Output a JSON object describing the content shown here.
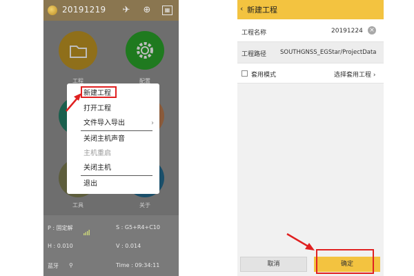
{
  "left_app": {
    "header_title": "20191219",
    "header_icons": [
      "satellite-icon",
      "rover-icon",
      "settings-panel-icon"
    ],
    "tiles": [
      {
        "name": "project",
        "label": "工程",
        "color": "#8f6f1a",
        "icon": "folder-icon"
      },
      {
        "name": "config",
        "label": "配置",
        "color": "#1f7a1f",
        "icon": "gear-icon"
      },
      {
        "name": "tools",
        "label": "工具",
        "color": "#1a5f4d"
      },
      {
        "name": "about",
        "label": "关于",
        "color": "#1a4f6a"
      }
    ],
    "menu": {
      "items": [
        {
          "label": "新建工程",
          "disabled": false
        },
        {
          "label": "打开工程",
          "disabled": false
        },
        {
          "label": "文件导入导出",
          "disabled": false,
          "chevron": "›"
        },
        {
          "label": "关闭主机声音",
          "disabled": false
        },
        {
          "label": "主机重启",
          "disabled": true
        },
        {
          "label": "关闭主机",
          "disabled": false
        },
        {
          "label": "退出",
          "disabled": false
        }
      ]
    },
    "status": {
      "p_label": "P : 固定解",
      "s_label": "S : G5+R4+C10",
      "h_label": "H : 0.010",
      "v_label": "V : 0.014",
      "bt_label": "蓝牙",
      "time_label": "Time : 09:34:11"
    }
  },
  "right_app": {
    "header": {
      "back": "‹",
      "title": "新建工程"
    },
    "project_name_label": "工程名称",
    "project_name_value": "20191224",
    "clear_glyph": "×",
    "project_path_label": "工程路径",
    "project_path_value": "SOUTHGNSS_EGStar/ProjectData",
    "template_mode_label": "套用模式",
    "template_select_label": "选择套用工程 ›",
    "cancel_label": "取消",
    "ok_label": "确定"
  },
  "colors": {
    "accent": "#f3c340",
    "highlight_red": "#e02020"
  }
}
